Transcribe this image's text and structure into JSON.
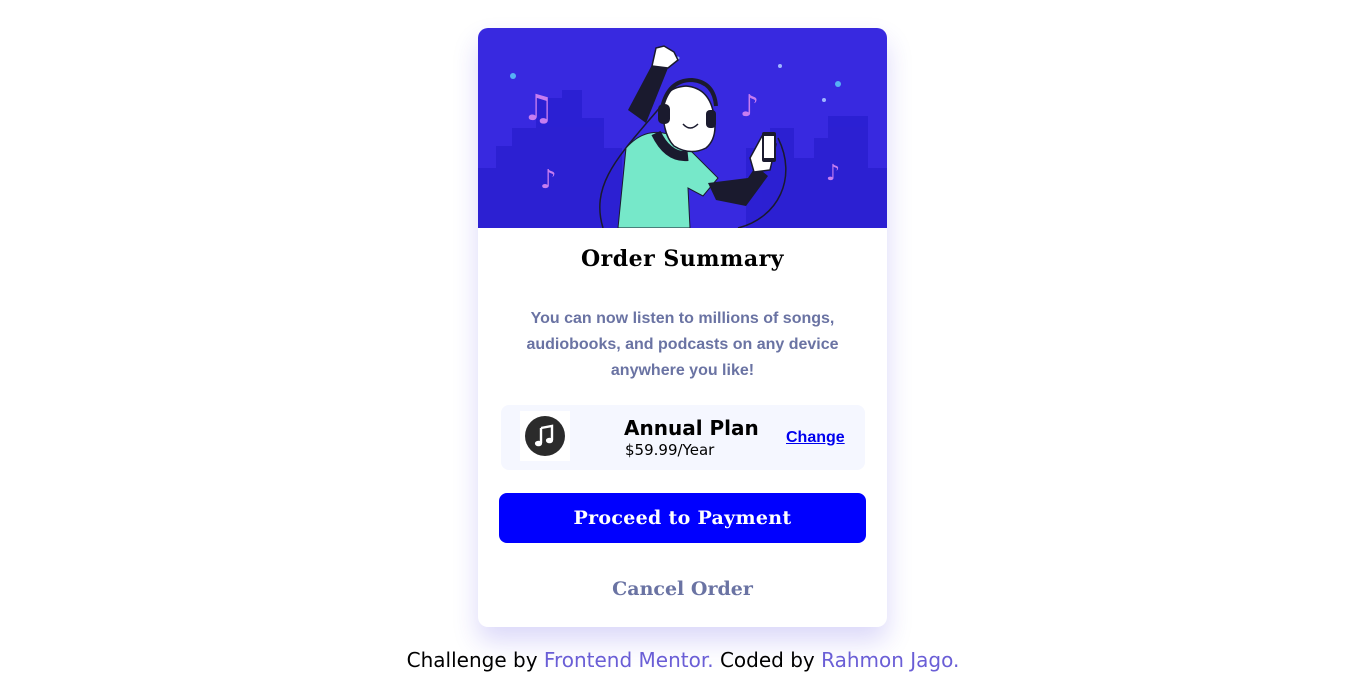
{
  "hero": {
    "image": "illustration-hero"
  },
  "card": {
    "title": "Order Summary",
    "description": "You can now listen to millions of songs, audiobooks, and podcasts on any device anywhere you like!",
    "plan": {
      "icon": "music-note-icon",
      "name": "Annual Plan",
      "price": "$59.99/Year",
      "change_label": "Change"
    },
    "proceed_label": "Proceed to Payment",
    "cancel_label": "Cancel Order"
  },
  "footer": {
    "prefix": "Challenge by",
    "challenge_link": "Frontend Mentor.",
    "middle": "Coded by",
    "author_link": "Rahmon Jago."
  },
  "colors": {
    "primary": "#0000ff",
    "hero_background": "#3829e0",
    "muted_text": "#6a73a3",
    "plan_background": "#f5f7ff",
    "footer_link": "#6a5ed6"
  }
}
